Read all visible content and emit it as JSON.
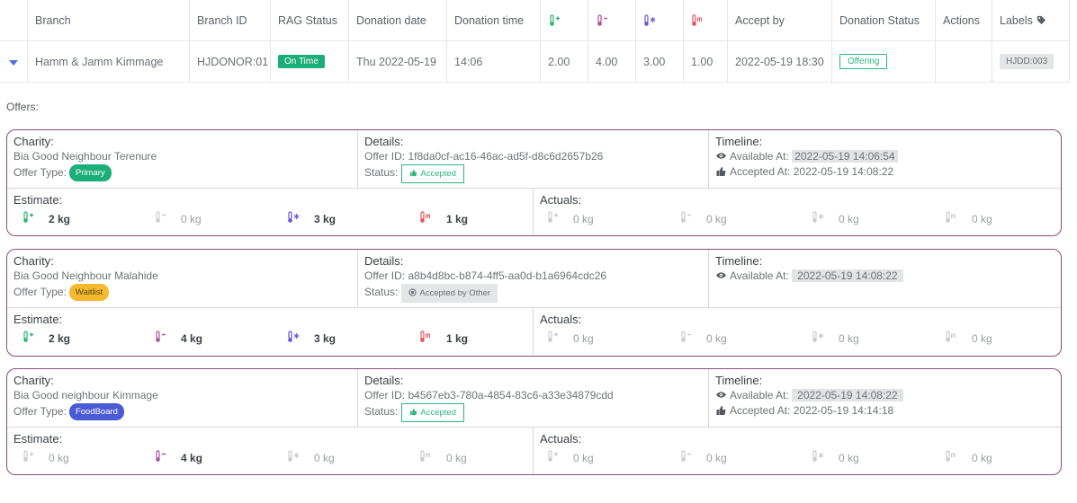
{
  "table": {
    "headers": {
      "branch": "Branch",
      "branch_id": "Branch ID",
      "rag_status": "RAG Status",
      "donation_date": "Donation date",
      "donation_time": "Donation time",
      "accept_by": "Accept by",
      "donation_status": "Donation Status",
      "actions": "Actions",
      "labels": "Labels"
    },
    "row": {
      "branch": "Hamm & Jamm Kimmage",
      "branch_id": "HJDONOR:01",
      "rag_status": "On Time",
      "donation_date": "Thu 2022-05-19",
      "donation_time": "14:06",
      "ambient": "2.00",
      "chilled": "4.00",
      "frozen": "3.00",
      "meat": "1.00",
      "accept_by": "2022-05-19 18:30",
      "donation_status": "Offering",
      "label": "HJDD:003"
    }
  },
  "offers_label": "Offers:",
  "labels": {
    "charity": "Charity:",
    "offer_type": "Offer Type:",
    "details": "Details:",
    "offer_id": "Offer ID:",
    "status": "Status:",
    "timeline": "Timeline:",
    "available_at": "Available At:",
    "accepted_at": "Accepted At:",
    "estimate": "Estimate:",
    "actuals": "Actuals:"
  },
  "offers": [
    {
      "charity": "Bia Good Neighbour Terenure",
      "offer_type": "Primary",
      "offer_id": "1f8da0cf-ac16-46ac-ad5f-d8c6d2657b26",
      "status": "Accepted",
      "available_at": "2022-05-19 14:06:54",
      "accepted_at": "2022-05-19 14:08:22",
      "estimate": [
        "2 kg",
        "0 kg",
        "3 kg",
        "1 kg"
      ],
      "actuals": [
        "0 kg",
        "0 kg",
        "0 kg",
        "0 kg"
      ]
    },
    {
      "charity": "Bia Good Neighbour Malahide",
      "offer_type": "Waitlist",
      "offer_id": "a8b4d8bc-b874-4ff5-aa0d-b1a6964cdc26",
      "status": "Accepted by Other",
      "available_at": "2022-05-19 14:08:22",
      "estimate": [
        "2 kg",
        "4 kg",
        "3 kg",
        "1 kg"
      ],
      "actuals": [
        "0 kg",
        "0 kg",
        "0 kg",
        "0 kg"
      ]
    },
    {
      "charity": "Bia Good neighbour Kimmage",
      "offer_type": "FoodBoard",
      "offer_id": "b4567eb3-780a-4854-83c6-a33e34879cdd",
      "status": "Accepted",
      "available_at": "2022-05-19 14:08:22",
      "accepted_at": "2022-05-19 14:14:18",
      "estimate": [
        "0 kg",
        "4 kg",
        "0 kg",
        "0 kg"
      ],
      "actuals": [
        "0 kg",
        "0 kg",
        "0 kg",
        "0 kg"
      ]
    }
  ],
  "colors": {
    "ambient": "#2bb673",
    "chilled": "#b04fa0",
    "frozen": "#6a57d4",
    "meat": "#e8505b",
    "primary": "#1cae78",
    "waitlist": "#f5b82e",
    "foodboard": "#4a5bd4",
    "card_border": "#8a4d7e",
    "faint_icon": "#c9cbce"
  },
  "icons": {
    "expand": "caret-down-icon",
    "labels": "tag-icon",
    "ambient": "thermometer-plus-icon",
    "chilled": "thermometer-minus-icon",
    "frozen": "thermometer-snowflake-icon",
    "meat": "thermometer-meat-icon",
    "available": "eye-icon",
    "accepted": "thumbs-up-icon",
    "accepted_by_other": "circle-dot-icon"
  }
}
